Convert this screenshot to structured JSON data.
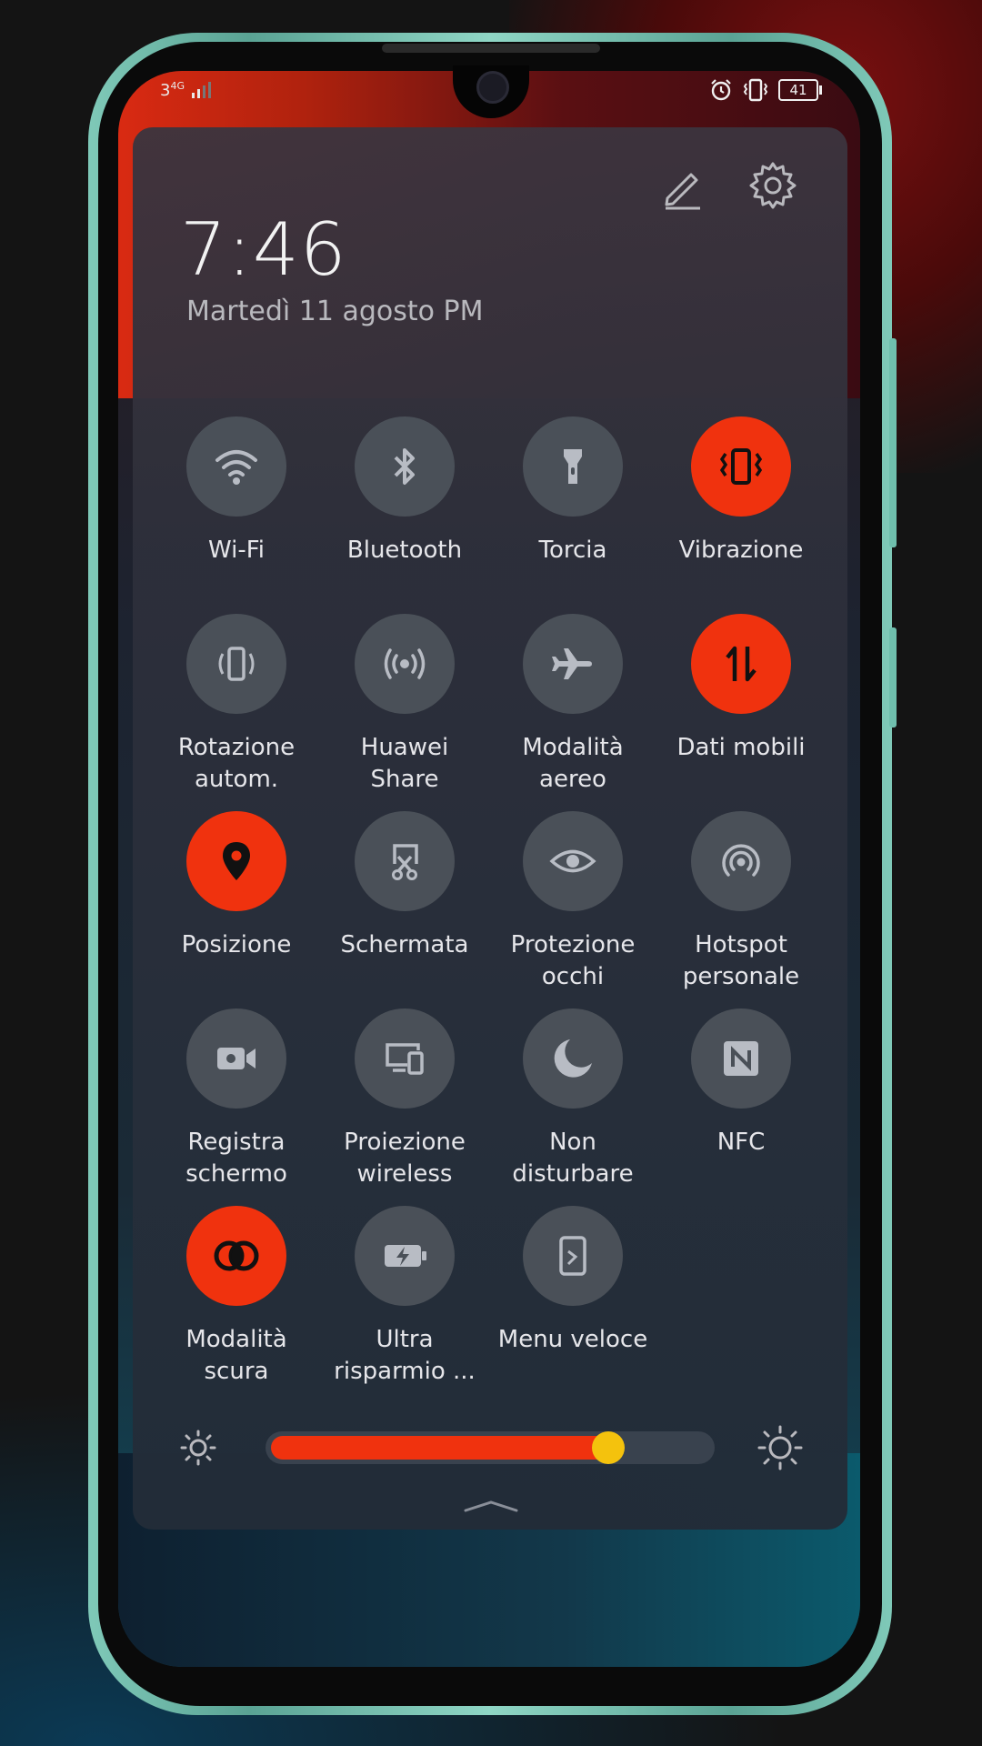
{
  "status_bar": {
    "signal_text": "3",
    "network_type": "4G",
    "battery_level": "41",
    "icons": [
      "alarm-icon",
      "vibrate-icon",
      "battery-icon"
    ]
  },
  "header": {
    "time": "7:46",
    "date": "Martedì 11 agosto  PM",
    "edit_icon": "pencil-icon",
    "settings_icon": "gear-icon"
  },
  "colors": {
    "active": "#f0320e",
    "inactive": "#4a5058",
    "slider_thumb": "#f4c20d"
  },
  "tiles": [
    {
      "label": "Wi-Fi",
      "icon": "wifi-icon",
      "active": false
    },
    {
      "label": "Bluetooth",
      "icon": "bluetooth-icon",
      "active": false
    },
    {
      "label": "Torcia",
      "icon": "flashlight-icon",
      "active": false
    },
    {
      "label": "Vibrazione",
      "icon": "vibrate-icon",
      "active": true
    },
    {
      "label": "Rotazione\nautom.",
      "icon": "auto-rotate-icon",
      "active": false
    },
    {
      "label": "Huawei\nShare",
      "icon": "huawei-share-icon",
      "active": false
    },
    {
      "label": "Modalità\naereo",
      "icon": "airplane-icon",
      "active": false
    },
    {
      "label": "Dati mobili",
      "icon": "mobile-data-icon",
      "active": true
    },
    {
      "label": "Posizione",
      "icon": "location-pin-icon",
      "active": true
    },
    {
      "label": "Schermata",
      "icon": "screenshot-icon",
      "active": false
    },
    {
      "label": "Protezione\nocchi",
      "icon": "eye-icon",
      "active": false
    },
    {
      "label": "Hotspot\npersonale",
      "icon": "hotspot-icon",
      "active": false
    },
    {
      "label": "Registra\nschermo",
      "icon": "video-camera-icon",
      "active": false
    },
    {
      "label": "Proiezione\nwireless",
      "icon": "wireless-projection-icon",
      "active": false
    },
    {
      "label": "Non\ndisturbare",
      "icon": "moon-icon",
      "active": false
    },
    {
      "label": "NFC",
      "icon": "nfc-icon",
      "active": false
    },
    {
      "label": "Modalità\nscura",
      "icon": "dark-mode-icon",
      "active": true
    },
    {
      "label": "Ultra\nrisparmio ...",
      "icon": "battery-saver-icon",
      "active": false
    },
    {
      "label": "Menu veloce",
      "icon": "quick-menu-icon",
      "active": false
    }
  ],
  "brightness": {
    "level": 0.77,
    "low_icon": "brightness-low-icon",
    "high_icon": "brightness-high-icon"
  },
  "handle_icon": "chevron-up-icon"
}
